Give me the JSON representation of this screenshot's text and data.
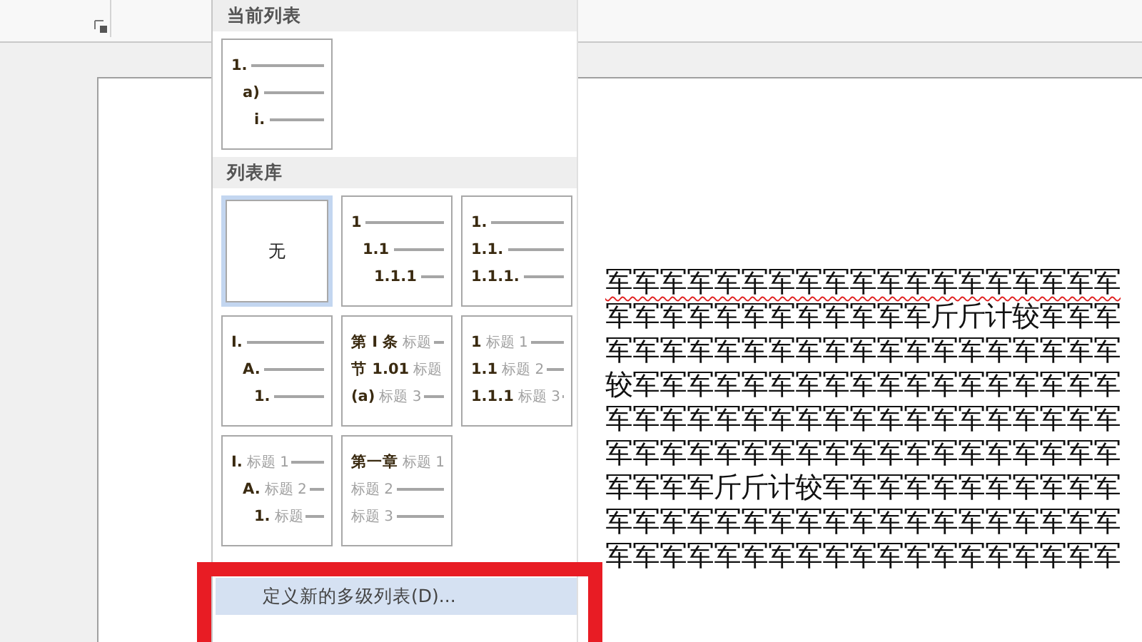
{
  "document": {
    "lines": [
      {
        "text": "军军军军军军军军军军军军军军军军军军军",
        "spelling_error": true
      },
      {
        "text": "军军军军军军军军军军军军斤斤计较军军军",
        "spelling_error": false
      },
      {
        "text": "军军军军军军军军军军军军军军军军军军军",
        "spelling_error": false
      },
      {
        "text": "较军军军军军军军军军军军军军军军军军军",
        "spelling_error": false
      },
      {
        "text": "军军军军军军军军军军军军军军军军军军军",
        "spelling_error": false
      },
      {
        "text": "军军军军军军军军军军军军军军军军军军军",
        "spelling_error": false
      },
      {
        "text": "军军军军斤斤计较军军军军军军军军军军军",
        "spelling_error": false
      },
      {
        "text": "军军军军军军军军军军军军军军军军军军军",
        "spelling_error": false
      },
      {
        "text": "军军军军军军军军军军军军军军军军军军军",
        "spelling_error": false
      }
    ]
  },
  "menu": {
    "current_section": {
      "title": "当前列表",
      "items": [
        {
          "selected": false,
          "levels": [
            {
              "number": "1.",
              "children": [
                {
                  "number": "a)",
                  "children": [
                    {
                      "number": "i."
                    }
                  ]
                }
              ]
            }
          ]
        }
      ]
    },
    "library_section": {
      "title": "列表库",
      "items": [
        {
          "selected": true,
          "kind": "none",
          "label": "无"
        },
        {
          "selected": false,
          "kind": "levels",
          "levels": [
            {
              "number": "1",
              "children": [
                {
                  "number": "1.1",
                  "children": [
                    {
                      "number": "1.1.1"
                    }
                  ]
                }
              ]
            }
          ]
        },
        {
          "selected": false,
          "kind": "levels",
          "levels": [
            {
              "number": "1."
            },
            {
              "number": "1.1."
            },
            {
              "number": "1.1.1."
            }
          ]
        },
        {
          "selected": false,
          "kind": "levels",
          "levels": [
            {
              "number": "I.",
              "children": [
                {
                  "number": "A.",
                  "children": [
                    {
                      "number": "1."
                    }
                  ]
                }
              ]
            }
          ]
        },
        {
          "selected": false,
          "kind": "levels",
          "levels": [
            {
              "number": "第 I 条",
              "heading": "标题"
            },
            {
              "number": "节 1.01",
              "heading": "标题"
            },
            {
              "number": "(a)",
              "heading": "标题 3"
            }
          ]
        },
        {
          "selected": false,
          "kind": "levels",
          "levels": [
            {
              "number": "1",
              "heading": "标题 1"
            },
            {
              "number": "1.1",
              "heading": "标题 2"
            },
            {
              "number": "1.1.1",
              "heading": "标题 3"
            }
          ]
        },
        {
          "selected": false,
          "kind": "levels",
          "levels": [
            {
              "number": "I.",
              "heading": "标题 1",
              "children": [
                {
                  "number": "A.",
                  "heading": "标题 2",
                  "children": [
                    {
                      "number": "1.",
                      "heading": "标题"
                    }
                  ]
                }
              ]
            }
          ]
        },
        {
          "selected": false,
          "kind": "levels",
          "levels": [
            {
              "number": "第一章",
              "heading": "标题 1"
            },
            {
              "heading": "标题 2"
            },
            {
              "heading": "标题 3"
            }
          ]
        }
      ]
    },
    "highlighted_item": {
      "label": "定义新的多级列表(D)...",
      "selected": true
    }
  }
}
